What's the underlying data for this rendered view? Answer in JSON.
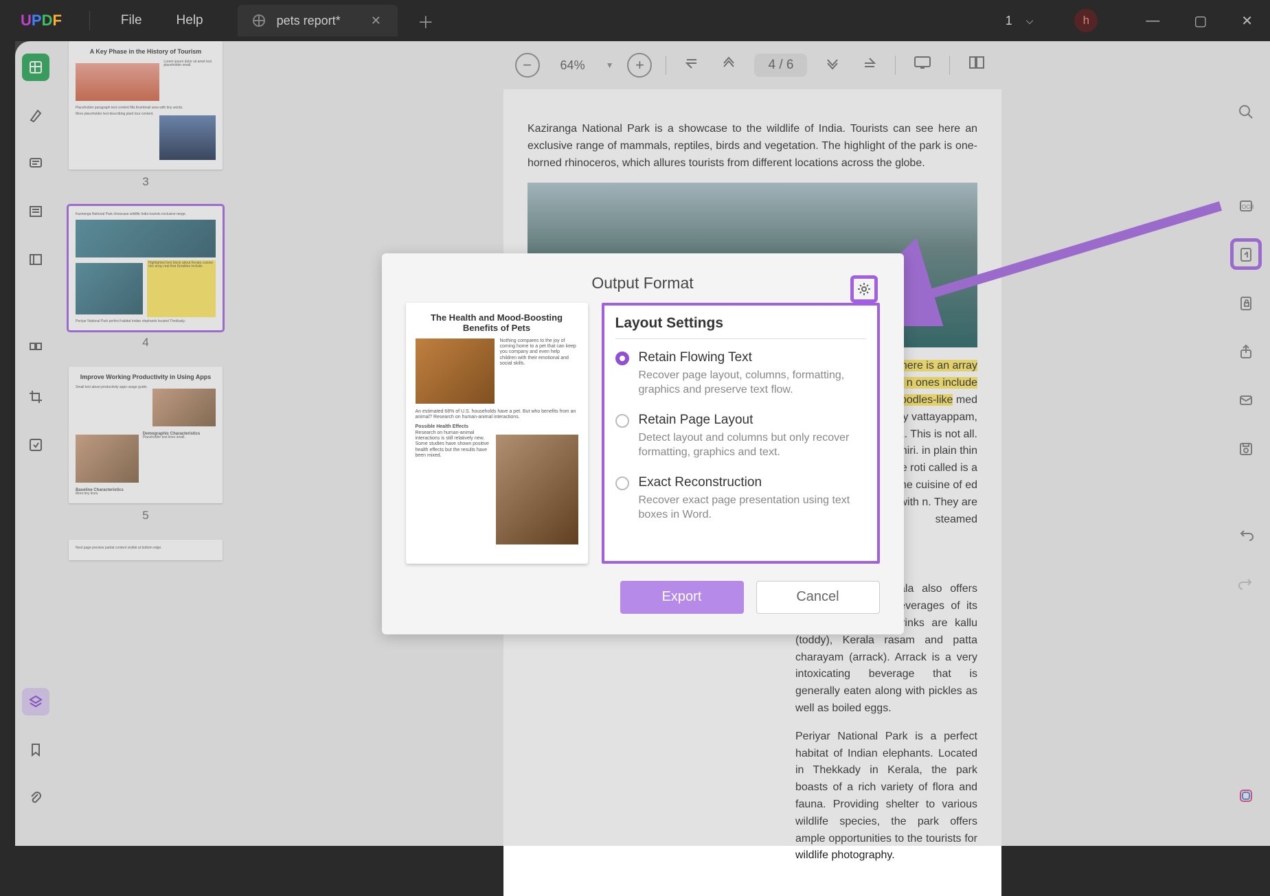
{
  "titlebar": {
    "file": "File",
    "help": "Help",
    "tab_title": "pets report*",
    "right_count": "1",
    "avatar": "h"
  },
  "toolbar": {
    "zoom": "64%",
    "page": "4 / 6"
  },
  "thumbnails": {
    "p3": {
      "title": "A Key Phase in the History of Tourism",
      "num": "3"
    },
    "p4": {
      "num": "4"
    },
    "p5": {
      "title": "Improve Working Productivity in Using Apps",
      "num": "5"
    }
  },
  "doc": {
    "p1": "Kaziranga National Park is a showcase to the wildlife of India. Tourists can see here an exclusive range of mammals, reptiles, birds and vegetation. The highlight of the park is one-horned rhinoceros, which allures tourists from different locations across the globe.",
    "p2_hl": "a is unpolished rice. there is an array of real that Keralites n ones include the u, the noodles-like",
    "p2": " med palappam, the spongy vattayappam, kallappam, and the ta. This is not all. The is called the pathiri. in plain thin bread a box type roti called is a sweet cake that rt of the cuisine of ed before filling with n. They are steamed",
    "p3": "The cuisine of Kerala also offers several fermented beverages of its own. The famous drinks are kallu (toddy), Kerala rasam and patta charayam (arrack). Arrack is a very intoxicating beverage that is generally eaten along with pickles as well as boiled eggs.",
    "p4": "Periyar National Park is a perfect habitat of Indian elephants. Located in Thekkady in Kerala, the park boasts of a rich variety of flora and fauna. Providing shelter to various wildlife species, the park offers ample opportunities to the tourists for wildlife photography."
  },
  "dialog": {
    "title": "Output Format",
    "settings_title": "Layout Settings",
    "preview_title": "The Health and Mood-Boosting Benefits of Pets",
    "opt1_t": "Retain Flowing Text",
    "opt1_d": "Recover page layout, columns, formatting, graphics and preserve text flow.",
    "opt2_t": "Retain Page Layout",
    "opt2_d": "Detect layout and columns but only recover formatting, graphics and text.",
    "opt3_t": "Exact Reconstruction",
    "opt3_d": "Recover exact page presentation using text boxes in Word.",
    "export": "Export",
    "cancel": "Cancel"
  }
}
